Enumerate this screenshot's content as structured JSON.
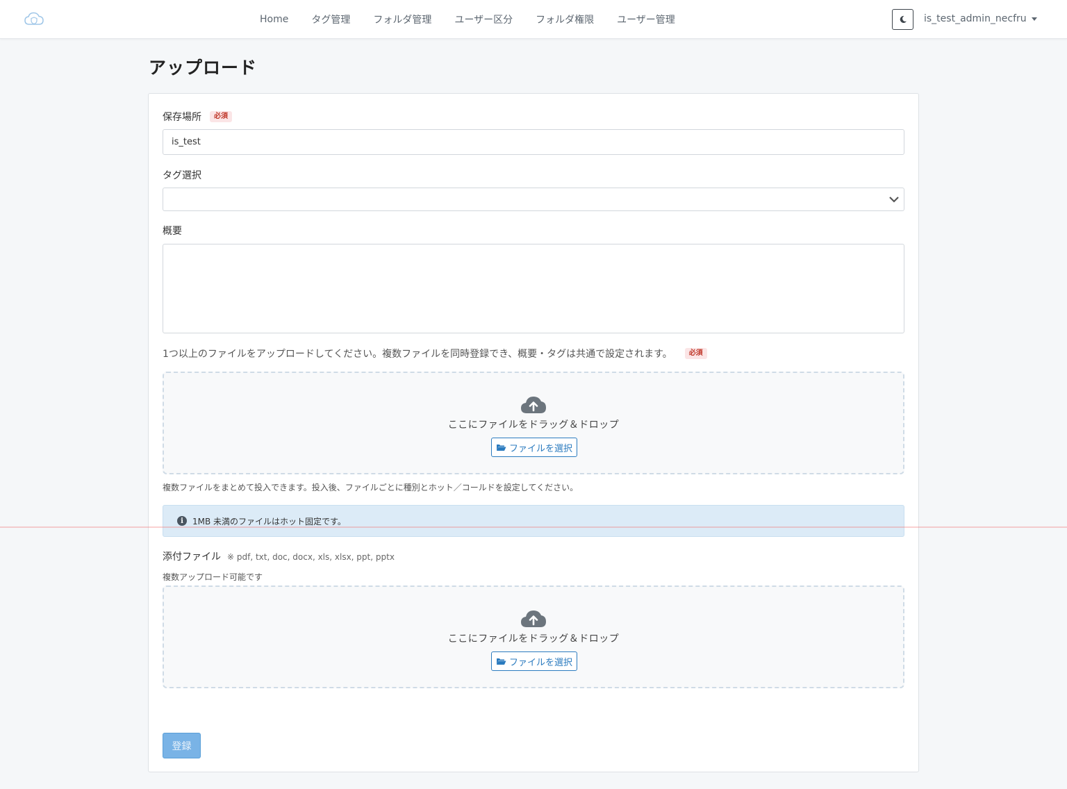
{
  "nav": {
    "links": [
      "Home",
      "タグ管理",
      "フォルダ管理",
      "ユーザー区分",
      "フォルダ権限",
      "ユーザー管理"
    ],
    "user": "is_test_admin_necfru",
    "theme_icon": "moon-icon"
  },
  "page": {
    "title": "アップロード"
  },
  "form": {
    "location_label": "保存場所",
    "required_badge": "必須",
    "location_value": "is_test",
    "tag_label": "タグ選択",
    "tag_value": "",
    "summary_label": "概要",
    "summary_value": "",
    "upload_hint": "1つ以上のファイルをアップロードしてください。複数ファイルを同時登録でき、概要・タグは共通で設定されます。",
    "dropzone_text": "ここにファイルをドラッグ＆ドロップ",
    "select_file_label": "ファイルを選択",
    "bulk_note": "複数ファイルをまとめて投入できます。投入後、ファイルごとに種別とホット／コールドを設定してください。",
    "info_text": "1MB 未満のファイルはホット固定です。",
    "attach_label": "添付ファイル",
    "attach_types": "※ pdf, txt, doc, docx, xls, xlsx, ppt, pptx",
    "attach_note": "複数アップロード可能です",
    "submit_label": "登録"
  }
}
